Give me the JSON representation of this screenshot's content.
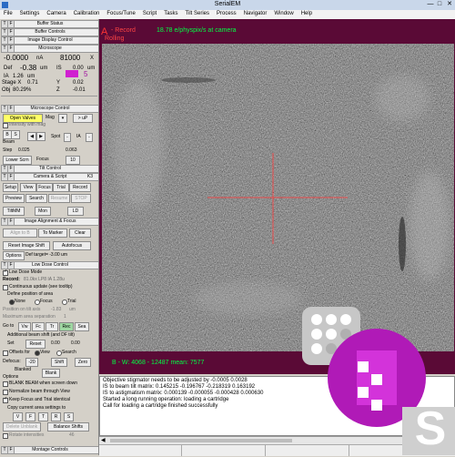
{
  "window": {
    "title": "SerialEM",
    "minimize": "—",
    "maximize": "□",
    "close": "✕"
  },
  "menu": [
    "File",
    "Settings",
    "Camera",
    "Calibration",
    "Focus/Tune",
    "Script",
    "Tasks",
    "Tilt Series",
    "Process",
    "Navigator",
    "Window",
    "Help"
  ],
  "panels": {
    "buffer_status": "Buffer Status",
    "buffer_controls": "Buffer Controls",
    "image_display": "Image Display Control",
    "microscope": "Microscope",
    "microscope_control": "Microscope Control",
    "camera_script": "Camera & Script",
    "camera_name": "K3",
    "tilt_control": "Tilt Control",
    "image_align": "Image Alignment & Focus",
    "low_dose_control": "Low Dose Control",
    "montage_controls": "Montage Controls"
  },
  "microscope": {
    "current_value": "-0.0000",
    "current_unit": "nA",
    "mag_value": "81000",
    "mag_unit": "X",
    "def_label": "Def",
    "def_value": "-0.38",
    "def_unit": "um",
    "is_label": "IS",
    "is_value": "0.00",
    "is_unit": "um",
    "spot_value": "5",
    "ia_label": "IA",
    "ia_value": "1.26",
    "ia_unit": "um",
    "stage_x_label": "Stage X",
    "stage_x": "0.71",
    "stage_y_label": "Y",
    "stage_y": "0.02",
    "obj_label": "Obj",
    "obj_value": "80.29%",
    "stage_z_label": "Z",
    "stage_z": "-0.01",
    "color_mag": "#d020d0"
  },
  "microscope_control": {
    "open_valves": "Open Valves",
    "mag_label": "Mag",
    "mag_up": "> uP",
    "intensity_zoom": "Intensity with mag",
    "beam_label": "Beam",
    "spot_label": "Spot",
    "ia_label": "IA",
    "step_label": "Step",
    "step_value_1": "0.025",
    "step_value_2": "0.063",
    "lower_scrn": "Lower Scrn",
    "focus_label": "Focus",
    "focus_step": "10"
  },
  "camera": {
    "setup": "Setup",
    "view": "View",
    "focus": "Focus",
    "trial": "Trial",
    "record": "Record",
    "preview": "Preview",
    "search": "Search",
    "resume": "Resume",
    "stop": "STOP",
    "montage": "TiltMM",
    "mon": "Mon",
    "ld": "LD"
  },
  "align_focus": {
    "align_to": "Align to B",
    "to_marker": "To Marker",
    "clear": "Clear",
    "reset_image_shift": "Reset Image Shift",
    "autofocus": "Autofocus",
    "options": "Options",
    "def_target": "Def target= -3.00 um"
  },
  "low_dose": {
    "low_dose_mode": "Low Dose Mode",
    "record_label": "Record:",
    "record_info": "81.0kx  LP8  IA  1.28u",
    "continuous_update": "Continuous update (see tooltip)",
    "define_position": "Define position of area",
    "none": "None",
    "focus": "Focus",
    "trial": "Trial",
    "position_label": "Position on tilt axis",
    "position_value": "-1.83",
    "position_unit": "um",
    "max_separation": "Maximum area separation",
    "max_value": "1",
    "goto_label": "Go to",
    "goto_vw": "Vw",
    "goto_fc": "Fc",
    "goto_tr": "Tr",
    "goto_rec": "Rec",
    "goto_sea": "Sea",
    "beam_shift_label": "Additional beam shift (and DF tilt)",
    "set_label": "Set",
    "reset_label": "Reset",
    "shift_value": "0.00",
    "shift_value_2": "0.00",
    "offsets_for": "Offsets for",
    "offsets_view": "View",
    "offsets_search": "Search",
    "defocus_label": "Defocus:",
    "defocus_value": "-20",
    "shift_btn": "Shift",
    "zero_btn": "Zero",
    "blanked": "Blanked",
    "blank_btn": "Blank",
    "options": "Options",
    "blank_beam": "BLANK BEAM when screen down",
    "normalize": "Normalize beam through View",
    "keep_focus": "Keep Focus and Trial identical",
    "copy_settings": "Copy current area settings to",
    "copy_v": "V",
    "copy_f": "F",
    "copy_t": "T",
    "copy_r": "R",
    "copy_s": "S",
    "delete_unblank": "Delete Unblank",
    "balance_shifts": "Balance Shifts",
    "rotate_label": "Rotate intensities",
    "rotate_value": "46"
  },
  "image": {
    "label_a": "A",
    "label_mode": "- Record",
    "label_rolling": "Rolling",
    "dose_rate": "18.78 e/physpix/s at camera",
    "stats": "B - W: 4068 - 12487  mean: 7577",
    "bg_color": "#5a0a36",
    "text_color": "#00ff44"
  },
  "log": [
    "Objective stigmator needs to be adjusted by -0.0005  0.0028",
    "IS to beam tilt matrix: 0.145215 -0.196767 -0.218319 0.163192",
    "IS to astigmatism matrix: 0.000139 -0.000055 -0.000428 0.000630",
    "Started a long running operation: loading a cartridge",
    "Call for loading a cartridge finished successfully"
  ],
  "logo": {
    "label": "S"
  }
}
